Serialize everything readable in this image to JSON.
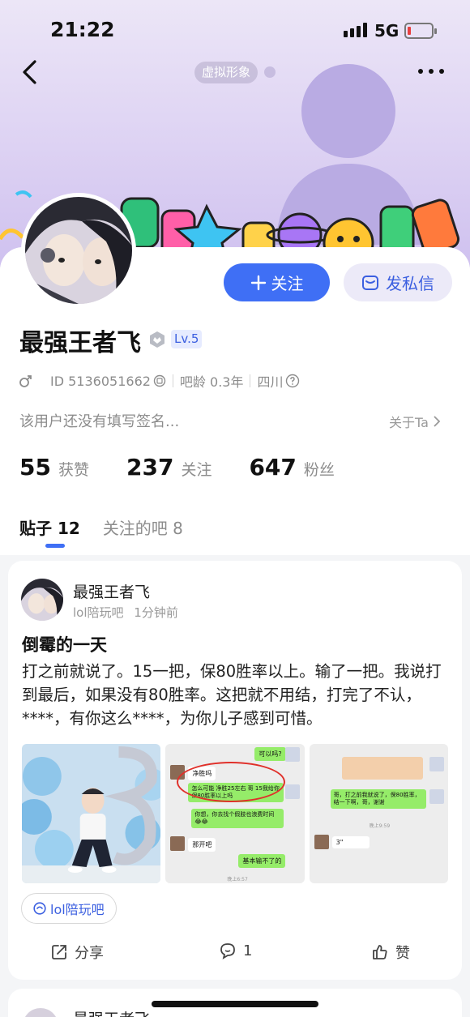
{
  "status_bar": {
    "time": "21:22",
    "network": "5G"
  },
  "header": {
    "virtual_tag": "虚拟形象"
  },
  "profile": {
    "name": "最强王者飞",
    "level": "Lv.5",
    "id_text": "ID 5136051662",
    "bar_age": "吧龄 0.3年",
    "location": "四川",
    "signature": "该用户还没有填写签名...",
    "about_label": "关于Ta",
    "follow_label": "关注",
    "message_label": "发私信"
  },
  "stats": [
    {
      "num": "55",
      "label": "获赞"
    },
    {
      "num": "237",
      "label": "关注"
    },
    {
      "num": "647",
      "label": "粉丝"
    }
  ],
  "tabs": [
    {
      "label": "贴子",
      "count": "12"
    },
    {
      "label": "关注的吧",
      "count": "8"
    }
  ],
  "post": {
    "author": "最强王者飞",
    "forum": "lol陪玩吧",
    "time": "1分钟前",
    "title": "倒霉的一天",
    "body": "打之前就说了。15一把，保80胜率以上。输了一把。我说打到最后，如果没有80胜率。这把就不用结，打完了不认，****，有你这么****，为你儿子感到可惜。",
    "forum_tag": "lol陪玩吧",
    "share_label": "分享",
    "comment_count": "1",
    "like_label": "赞",
    "images": {
      "img2": {
        "msg_top": "可以吗?",
        "msg_a": "净胜吗",
        "msg_b": "怎么可能  净胜25左右 哥  15我给你保80胜率以上吗",
        "msg_c": "你想，你去找个假肢也浪费时间 😂😂",
        "msg_d": "那开吧",
        "msg_e": "基本输不了的",
        "time_d": "晚上6:57"
      },
      "img3": {
        "msg_a": "哥，打之前我就说了，保80胜率，结一下啊，哥，谢谢",
        "time_a": "晚上9:59",
        "msg_b": "3\""
      }
    }
  },
  "post2": {
    "author": "最强王者飞"
  },
  "colors": {
    "accent": "#3f6ff5",
    "banner": "#ddd2f3"
  }
}
